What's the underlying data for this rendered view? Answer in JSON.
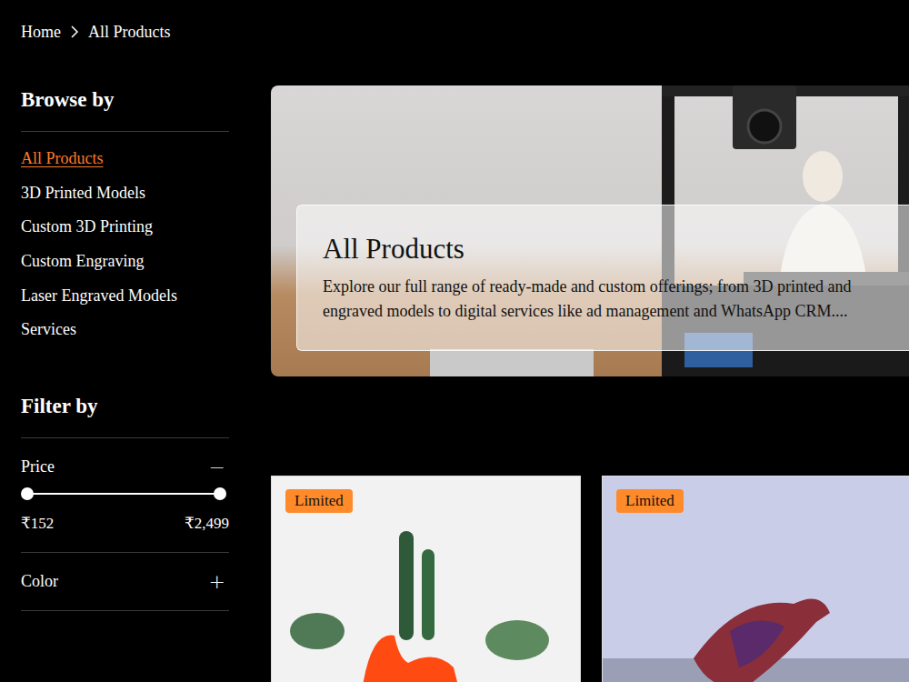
{
  "breadcrumb": [
    {
      "label": "Home"
    },
    {
      "label": "All Products"
    }
  ],
  "sidebar": {
    "browse_title": "Browse by",
    "items": [
      {
        "label": "All Products",
        "selected": true
      },
      {
        "label": "3D Printed Models",
        "selected": false
      },
      {
        "label": "Custom 3D Printing",
        "selected": false
      },
      {
        "label": "Custom Engraving",
        "selected": false
      },
      {
        "label": "Laser Engraved Models",
        "selected": false
      },
      {
        "label": "Services",
        "selected": false
      }
    ],
    "filter_title": "Filter by",
    "filters": [
      {
        "kind": "range",
        "label": "Price",
        "toggle": "−",
        "expanded": true,
        "min_label": "₹152",
        "max_label": "₹2,499",
        "low": 0,
        "high": 1
      },
      {
        "kind": "collapsed",
        "label": "Color",
        "toggle": "+",
        "expanded": false
      }
    ]
  },
  "hero": {
    "title": "All Products",
    "lines": [
      "Explore our full range of ready-made and custom offerings; from 3D printed and",
      "engraved models to digital services like ad management and WhatsApp CRM...."
    ]
  },
  "products": [
    {
      "badge": "Limited"
    },
    {
      "badge": "Limited"
    }
  ]
}
